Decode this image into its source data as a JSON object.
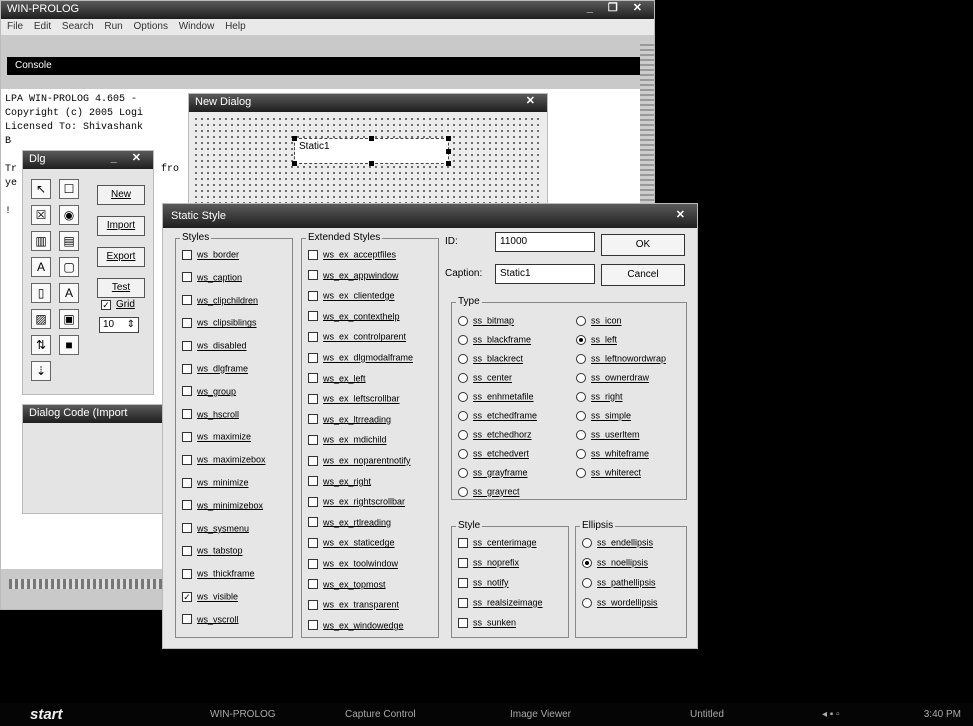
{
  "main_window": {
    "title": "WIN-PROLOG",
    "controls": "_ ❐ ✕",
    "menu": "File  Edit  Search  Run  Options  Window  Help",
    "console_title": "Console",
    "console_text": "LPA WIN-PROLOG 4.605 -\nCopyright (c) 2005 Logi\nLicensed To: Shivashank\nB\n\nTr                        fro\nye\n\n!"
  },
  "new_dialog": {
    "title": "New Dialog",
    "close": "✕",
    "static_label": "Static1"
  },
  "dlg_toolbox": {
    "title": "Dlg",
    "controls": "_ ✕",
    "tools": [
      "↖",
      "☐",
      "☒",
      "◉",
      "▥",
      "▤",
      "A",
      "▢",
      "▯",
      "A",
      "▨",
      "▣",
      "⇅",
      "■",
      "⇣",
      ""
    ],
    "buttons": [
      "New",
      "Import",
      "Export",
      "Test"
    ],
    "grid_label": "Grid",
    "grid_value": "10"
  },
  "dialog_code": {
    "title": "Dialog Code (Import"
  },
  "static_style": {
    "title": "Static Style",
    "close": "✕",
    "styles_label": "Styles",
    "styles": [
      {
        "label": "ws_border",
        "checked": false
      },
      {
        "label": "ws_caption",
        "checked": false
      },
      {
        "label": "ws_clipchildren",
        "checked": false
      },
      {
        "label": "ws_clipsiblings",
        "checked": false
      },
      {
        "label": "ws_disabled",
        "checked": false
      },
      {
        "label": "ws_dlgframe",
        "checked": false
      },
      {
        "label": "ws_group",
        "checked": false
      },
      {
        "label": "ws_hscroll",
        "checked": false
      },
      {
        "label": "ws_maximize",
        "checked": false
      },
      {
        "label": "ws_maximizebox",
        "checked": false
      },
      {
        "label": "ws_minimize",
        "checked": false
      },
      {
        "label": "ws_minimizebox",
        "checked": false
      },
      {
        "label": "ws_sysmenu",
        "checked": false
      },
      {
        "label": "ws_tabstop",
        "checked": false
      },
      {
        "label": "ws_thickframe",
        "checked": false
      },
      {
        "label": "ws_visible",
        "checked": true
      },
      {
        "label": "ws_vscroll",
        "checked": false
      }
    ],
    "ext_label": "Extended Styles",
    "ext_styles": [
      "ws_ex_acceptfiles",
      "ws_ex_appwindow",
      "ws_ex_clientedge",
      "ws_ex_contexthelp",
      "ws_ex_controlparent",
      "ws_ex_dlgmodalframe",
      "ws_ex_left",
      "ws_ex_leftscrollbar",
      "ws_ex_ltrreading",
      "ws_ex_mdichild",
      "ws_ex_noparentnotify",
      "ws_ex_right",
      "ws_ex_rightscrollbar",
      "ws_ex_rtlreading",
      "ws_ex_staticedge",
      "ws_ex_toolwindow",
      "ws_ex_topmost",
      "ws_ex_transparent",
      "ws_ex_windowedge"
    ],
    "id_label": "ID:",
    "id_value": "11000",
    "caption_label": "Caption:",
    "caption_value": "Static1",
    "ok_label": "OK",
    "cancel_label": "Cancel",
    "type_label": "Type",
    "type_left": [
      {
        "label": "ss_bitmap",
        "on": false
      },
      {
        "label": "ss_blackframe",
        "on": false
      },
      {
        "label": "ss_blackrect",
        "on": false
      },
      {
        "label": "ss_center",
        "on": false
      },
      {
        "label": "ss_enhmetafile",
        "on": false
      },
      {
        "label": "ss_etchedframe",
        "on": false
      },
      {
        "label": "ss_etchedhorz",
        "on": false
      },
      {
        "label": "ss_etchedvert",
        "on": false
      },
      {
        "label": "ss_grayframe",
        "on": false
      },
      {
        "label": "ss_grayrect",
        "on": false
      }
    ],
    "type_right": [
      {
        "label": "ss_icon",
        "on": false
      },
      {
        "label": "ss_left",
        "on": true
      },
      {
        "label": "ss_leftnowordwrap",
        "on": false
      },
      {
        "label": "ss_ownerdraw",
        "on": false
      },
      {
        "label": "ss_right",
        "on": false
      },
      {
        "label": "ss_simple",
        "on": false
      },
      {
        "label": "ss_userltem",
        "on": false
      },
      {
        "label": "ss_whiteframe",
        "on": false
      },
      {
        "label": "ss_whiterect",
        "on": false
      }
    ],
    "style_label": "Style",
    "style_items": [
      "ss_centerimage",
      "ss_noprefix",
      "ss_notify",
      "ss_realsizeimage",
      "ss_sunken"
    ],
    "ellipsis_label": "Ellipsis",
    "ellipsis_items": [
      {
        "label": "ss_endellipsis",
        "on": false
      },
      {
        "label": "ss_noellipsis",
        "on": true
      },
      {
        "label": "ss_pathellipsis",
        "on": false
      },
      {
        "label": "ss_wordellipsis",
        "on": false
      }
    ]
  },
  "taskbar": {
    "start": "start",
    "items": [
      "WIN-PROLOG",
      "Capture Control",
      "Image Viewer",
      "Untitled"
    ],
    "clock": "3:40 PM"
  }
}
